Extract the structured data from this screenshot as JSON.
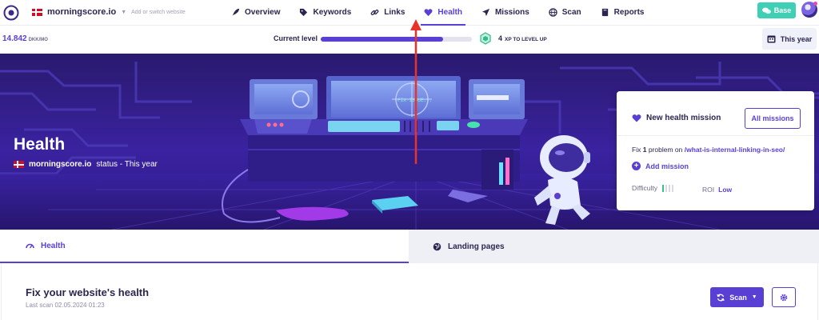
{
  "topbar": {
    "site_name": "morningscore.io",
    "site_hint": "Add or switch website",
    "nav": [
      {
        "label": "Overview",
        "icon": "rocket-icon"
      },
      {
        "label": "Keywords",
        "icon": "tag-icon"
      },
      {
        "label": "Links",
        "icon": "link-icon"
      },
      {
        "label": "Health",
        "icon": "heart-icon",
        "active": true
      },
      {
        "label": "Missions",
        "icon": "plane-icon"
      },
      {
        "label": "Scan",
        "icon": "globe-icon"
      },
      {
        "label": "Reports",
        "icon": "book-icon"
      }
    ],
    "base_label": "Base"
  },
  "subbar": {
    "price": "14.842",
    "price_unit": "DKK/MO",
    "level_label": "Current level",
    "level_progress": 0.81,
    "xp_value": "4",
    "xp_unit": "XP TO LEVEL UP",
    "period_label": "This year"
  },
  "hero": {
    "title": "Health",
    "site": "morningscore.io",
    "status_text": "status - This year",
    "screen_text": "FIX ISSUE..."
  },
  "mission": {
    "title": "New health mission",
    "all_button": "All missions",
    "fix_prefix": "Fix",
    "fix_count": "1",
    "fix_middle": "problem on",
    "fix_path": "/what-is-internal-linking-in-seo/",
    "add_label": "Add mission",
    "difficulty_label": "Difficulty",
    "difficulty_level": 1,
    "roi_label": "ROI",
    "roi_value": "Low"
  },
  "tabs": [
    {
      "label": "Health",
      "icon": "gauge-icon",
      "active": true
    },
    {
      "label": "Landing pages",
      "icon": "globe-icon"
    }
  ],
  "content": {
    "title": "Fix your website's health",
    "last_scan": "Last scan 02.05.2024 01:23",
    "scan_button": "Scan"
  },
  "colors": {
    "accent": "#5a3fd4",
    "base_button": "#3ecfb5",
    "hero_bg": "#2a1a6e",
    "annotation_arrow": "#e8332a"
  }
}
